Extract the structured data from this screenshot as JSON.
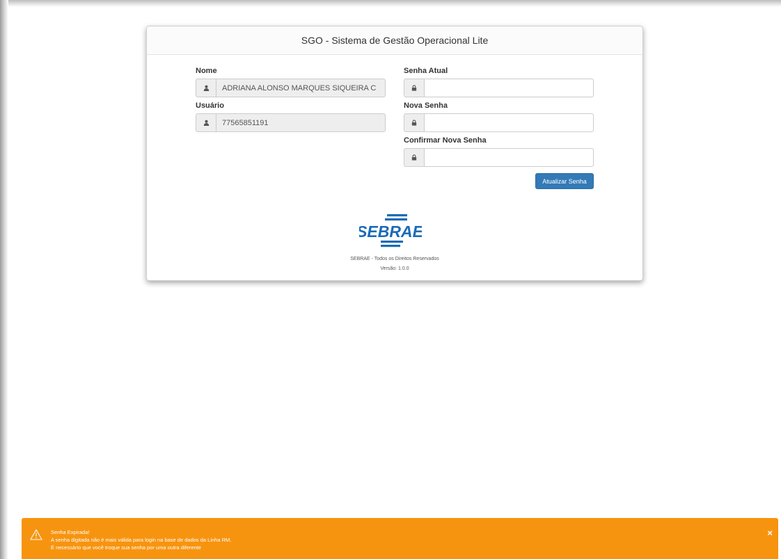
{
  "panel": {
    "title": "SGO - Sistema de Gestão Operacional Lite"
  },
  "left_form": {
    "nome_label": "Nome",
    "nome_value": "ADRIANA ALONSO MARQUES SIQUEIRA C",
    "usuario_label": "Usuário",
    "usuario_value": "77565851191"
  },
  "right_form": {
    "senha_atual_label": "Senha Atual",
    "nova_senha_label": "Nova Senha",
    "confirmar_label": "Confirmar Nova Senha",
    "button_label": "Atualizar Senha"
  },
  "footer": {
    "logo_text": "SEBRAE",
    "rights": "SEBRAE - Todos os Direitos Reservados",
    "version": "Versão: 1.0.0"
  },
  "alert": {
    "title": "Senha Expirada!",
    "line1": "A senha digitada não é mais válida para login na base de dados da Linha RM.",
    "line2": "É necessário que você troque sua senha por uma outra diferente",
    "close": "×"
  },
  "colors": {
    "primary_button": "#337ab7",
    "alert_background": "#f7940f",
    "logo_blue": "#1b6bb6"
  },
  "icons": {
    "user": "user-icon",
    "lock": "lock-icon",
    "warning": "warning-icon",
    "close": "close-icon"
  }
}
